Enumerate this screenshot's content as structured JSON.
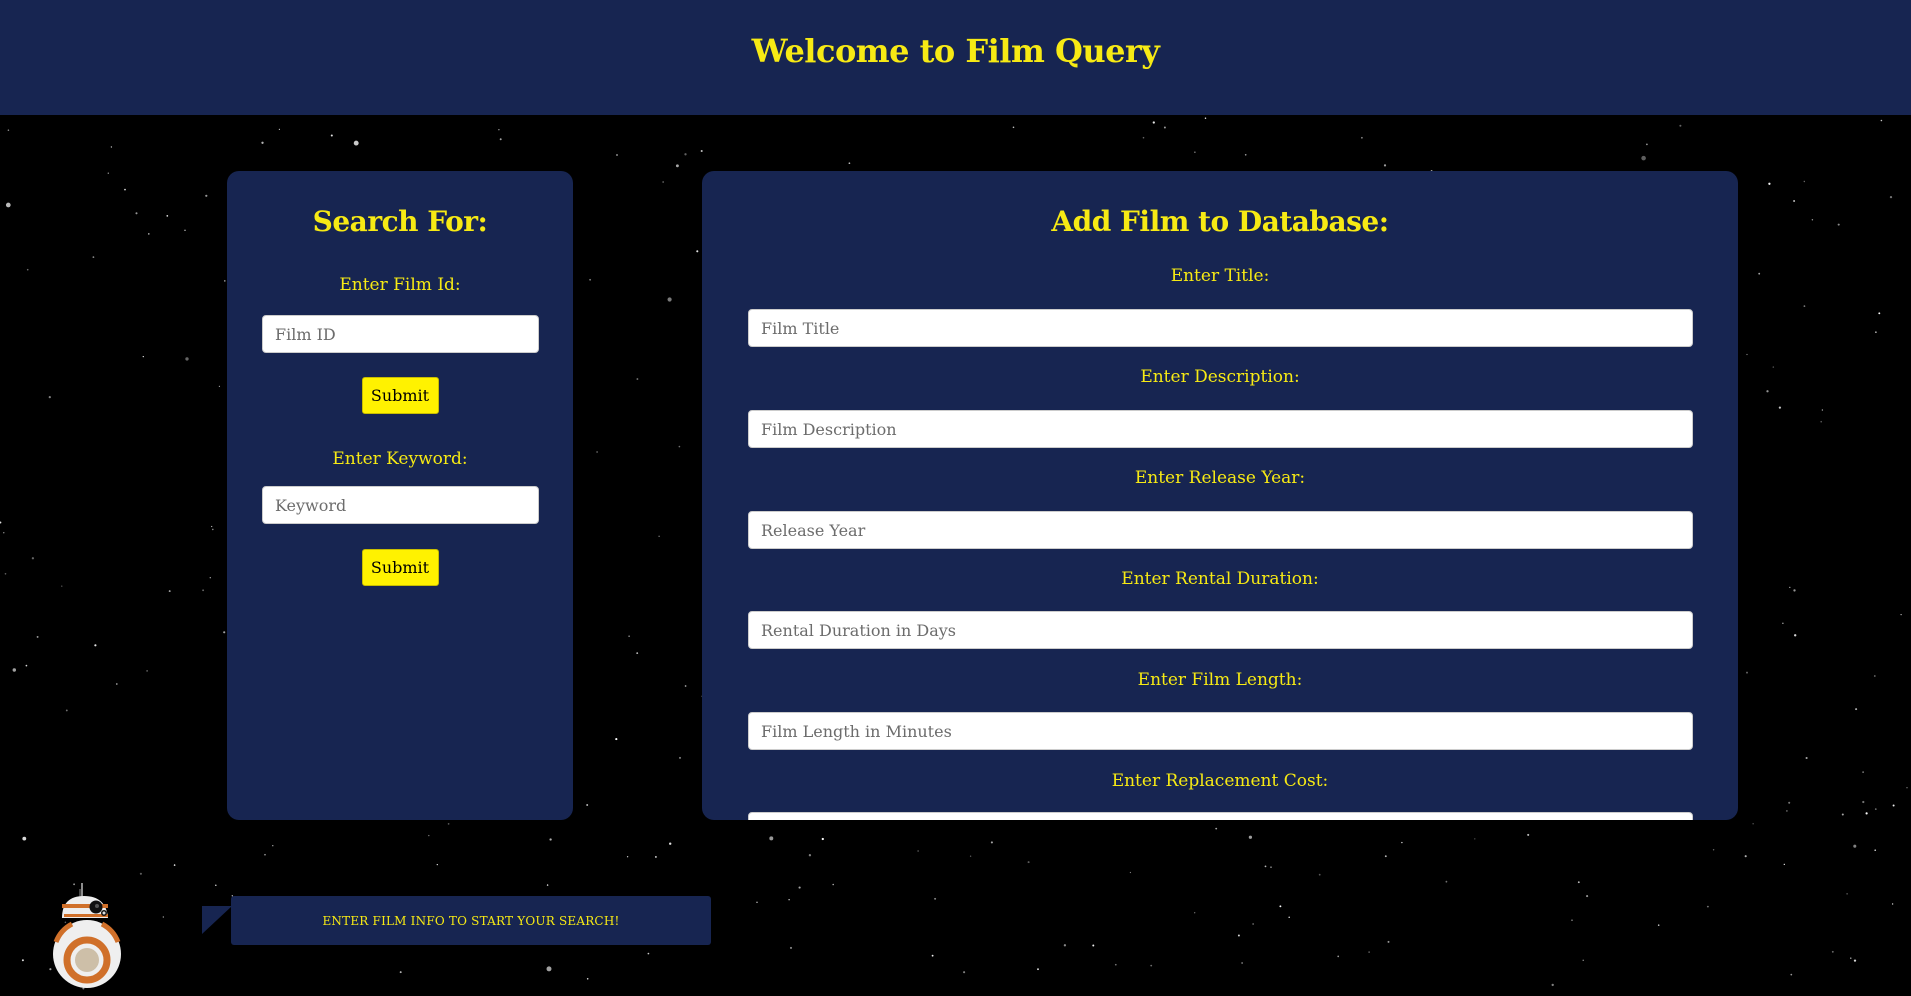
{
  "colors": {
    "navy": "#172551",
    "accent_yellow": "#f7ea14",
    "background": "#000000"
  },
  "header": {
    "title": "Welcome to Film Query"
  },
  "search_panel": {
    "title": "Search For:",
    "film_id_label": "Enter Film Id:",
    "film_id_placeholder": "Film ID",
    "submit_label": "Submit",
    "keyword_label": "Enter Keyword:",
    "keyword_placeholder": "Keyword",
    "submit_label_2": "Submit"
  },
  "add_panel": {
    "title": "Add Film to Database:",
    "fields": [
      {
        "label": "Enter Title:",
        "placeholder": "Film Title"
      },
      {
        "label": "Enter Description:",
        "placeholder": "Film Description"
      },
      {
        "label": "Enter Release Year:",
        "placeholder": "Release Year"
      },
      {
        "label": "Enter Rental Duration:",
        "placeholder": "Rental Duration in Days"
      },
      {
        "label": "Enter Film Length:",
        "placeholder": "Film Length in Minutes"
      },
      {
        "label": "Enter Replacement Cost:",
        "placeholder": ""
      }
    ]
  },
  "droid_message": {
    "icon": "bb8-droid-icon",
    "text": "Enter film info to start your search!"
  }
}
